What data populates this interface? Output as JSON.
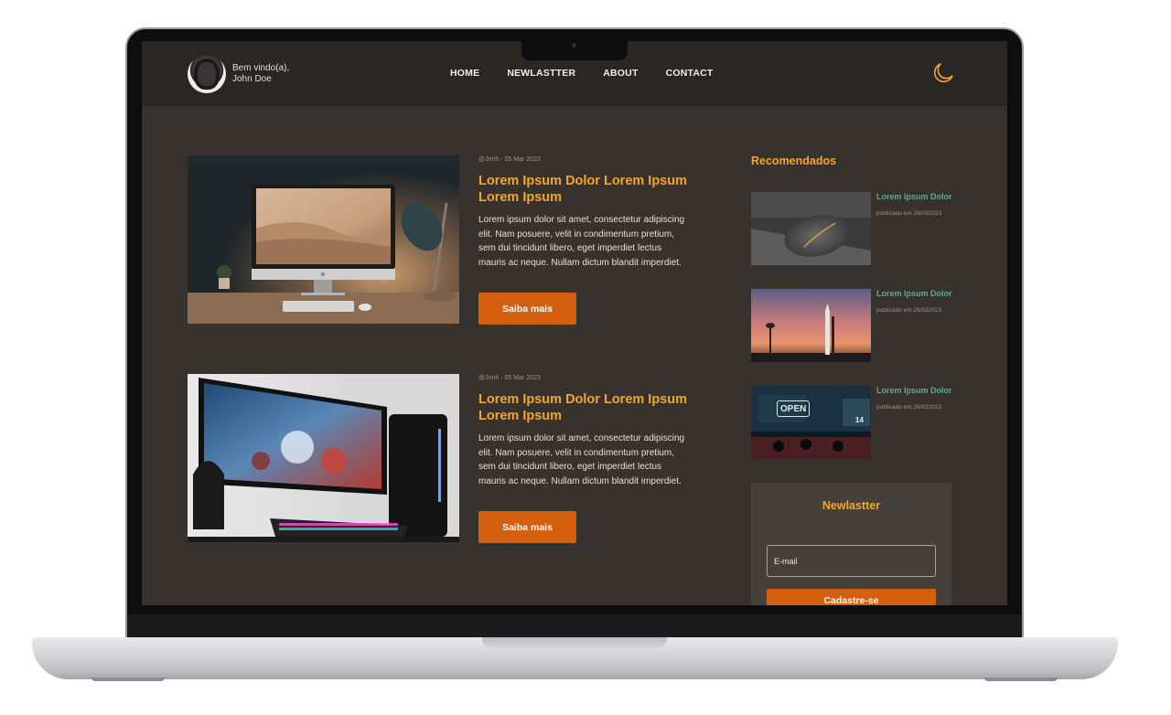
{
  "header": {
    "welcome_line1": "Bem vindo(a),",
    "welcome_line2": "John Doe",
    "nav": [
      "HOME",
      "NEWLASTTER",
      "ABOUT",
      "CONTACT"
    ],
    "theme_icon": "moon-icon"
  },
  "posts": [
    {
      "meta": "@Jonh - 05 Mar 2023",
      "title": "Lorem Ipsum Dolor Lorem Ipsum Lorem Ipsum",
      "text": "Lorem ipsum dolor sit amet, consectetur adipiscing elit. Nam posuere, velit in condimentum pretium, sem dui tincidunt libero, eget imperdiet lectus mauris ac neque. Nullam dictum blandit imperdiet.",
      "button": "Saiba mais"
    },
    {
      "meta": "@Jonh - 05 Mar 2023",
      "title": "Lorem Ipsum Dolor Lorem Ipsum Lorem Ipsum",
      "text": "Lorem ipsum dolor sit amet, consectetur adipiscing elit. Nam posuere, velit in condimentum pretium, sem dui tincidunt libero, eget imperdiet lectus mauris ac neque. Nullam dictum blandit imperdiet.",
      "button": "Saiba mais"
    }
  ],
  "sidebar": {
    "title": "Recomendados",
    "items": [
      {
        "title": "Lorem Ipsum Dolor",
        "date": "publicado em 26/032023"
      },
      {
        "title": "Lorem Ipsum Dolor",
        "date": "publicado em 26/032023"
      },
      {
        "title": "Lorem Ipsum Dolor",
        "date": "publicado em 26/032023"
      }
    ],
    "open_sign": "OPEN",
    "score": "14"
  },
  "newsletter": {
    "title": "Newlastter",
    "email_placeholder": "E-mail",
    "button": "Cadastre-se"
  },
  "colors": {
    "background": "#37322e",
    "header": "#292624",
    "accent": "#f3a62a",
    "button": "#d4600f",
    "link_green": "#5dab8f"
  }
}
